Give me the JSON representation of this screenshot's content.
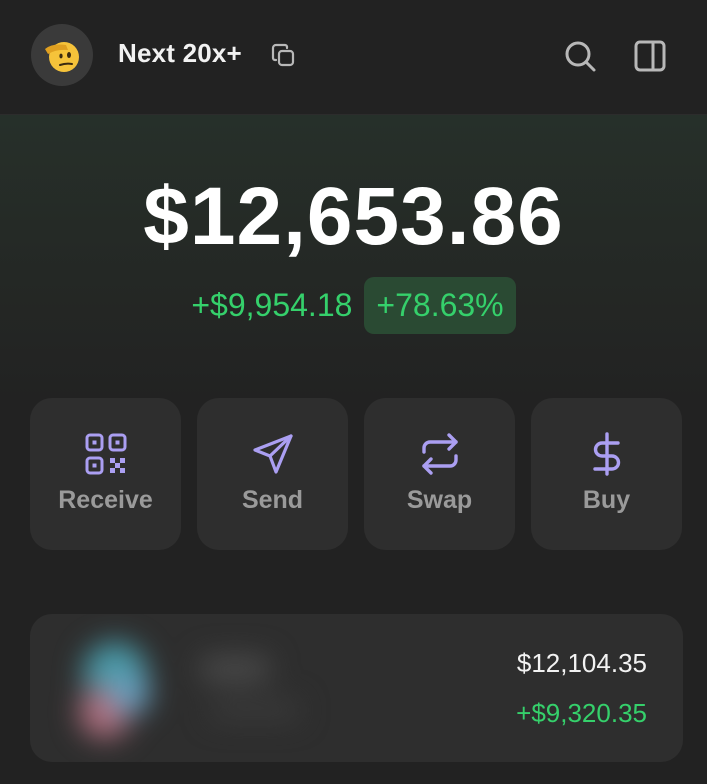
{
  "header": {
    "wallet_name": "Next 20x+",
    "avatar_icon": "saluting-face-emoji",
    "copy_icon": "copy-icon",
    "search_icon": "search-icon",
    "panel_icon": "sidebar-panel-icon"
  },
  "balance": {
    "total": "$12,653.86",
    "change_amount": "+$9,954.18",
    "change_percent": "+78.63%"
  },
  "actions": [
    {
      "label": "Receive",
      "icon": "qr-code-icon"
    },
    {
      "label": "Send",
      "icon": "send-arrow-icon"
    },
    {
      "label": "Swap",
      "icon": "swap-arrows-icon"
    },
    {
      "label": "Buy",
      "icon": "dollar-icon"
    }
  ],
  "token": {
    "value": "$12,104.35",
    "change": "+$9,320.35"
  },
  "colors": {
    "background": "#222222",
    "card": "#2e2e2e",
    "accent_purple": "#ab9ff2",
    "positive_green": "#35d06b",
    "positive_badge_bg": "#2a4a33"
  }
}
